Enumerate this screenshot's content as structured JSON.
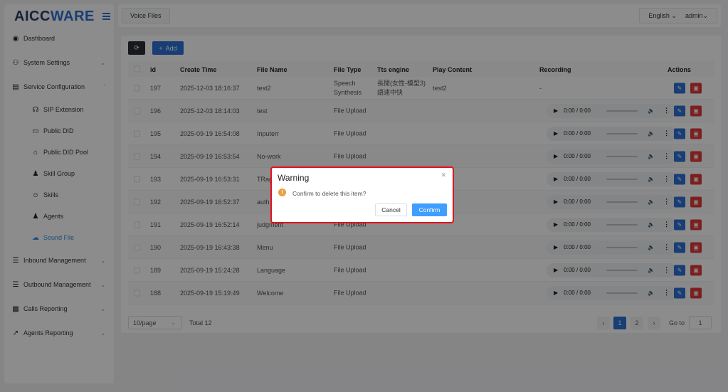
{
  "logo": {
    "main": "AICC",
    "accent": "WARE"
  },
  "sidebar": {
    "items": [
      {
        "label": "Dashboard",
        "icon": "dashboard-icon"
      },
      {
        "label": "System Settings",
        "icon": "users-icon"
      },
      {
        "label": "Service Configuration",
        "icon": "id-card-icon"
      },
      {
        "label": "SIP Extension",
        "icon": "headset-icon"
      },
      {
        "label": "Public DID",
        "icon": "folder-icon"
      },
      {
        "label": "Public DID Pool",
        "icon": "home-icon"
      },
      {
        "label": "Skill Group",
        "icon": "user-group-icon"
      },
      {
        "label": "Skills",
        "icon": "user-icon"
      },
      {
        "label": "Agents",
        "icon": "user-icon"
      },
      {
        "label": "Sound File",
        "icon": "cloud-icon",
        "active": true
      },
      {
        "label": "Inbound Management",
        "icon": "list-icon"
      },
      {
        "label": "Outbound Management",
        "icon": "list-icon"
      },
      {
        "label": "Calls Reporting",
        "icon": "bar-chart-icon"
      },
      {
        "label": "Agents Reporting",
        "icon": "line-chart-icon"
      }
    ]
  },
  "topbar": {
    "tab": "Voice Files",
    "language": "English",
    "user": "admin"
  },
  "toolbar": {
    "add_label": "Add"
  },
  "table": {
    "headers": [
      "id",
      "Create Time",
      "File Name",
      "File Type",
      "Tts engine",
      "Play Content",
      "Recording",
      "Actions"
    ],
    "rows": [
      {
        "id": "197",
        "time": "2025-12-03 18:16:37",
        "name": "test2",
        "type": "Speech Synthesis",
        "tts": "長閒(女性-模型3) 語速中快",
        "content": "test2",
        "recording": "-"
      },
      {
        "id": "196",
        "time": "2025-12-03 18:14:03",
        "name": "test",
        "type": "File Upload",
        "tts": "",
        "content": "",
        "recording": "0:00 / 0:00"
      },
      {
        "id": "195",
        "time": "2025-09-19 16:54:08",
        "name": "Inputerr",
        "type": "File Upload",
        "tts": "",
        "content": "",
        "recording": "0:00 / 0:00"
      },
      {
        "id": "194",
        "time": "2025-09-19 16:53:54",
        "name": "No-work",
        "type": "File Upload",
        "tts": "",
        "content": "",
        "recording": "0:00 / 0:00"
      },
      {
        "id": "193",
        "time": "2025-09-19 16:53:31",
        "name": "TRage",
        "type": "",
        "tts": "",
        "content": "",
        "recording": "0:00 / 0:00"
      },
      {
        "id": "192",
        "time": "2025-09-19 16:52:37",
        "name": "auth",
        "type": "",
        "tts": "",
        "content": "",
        "recording": "0:00 / 0:00"
      },
      {
        "id": "191",
        "time": "2025-09-19 16:52:14",
        "name": "judgment",
        "type": "File Upload",
        "tts": "",
        "content": "",
        "recording": "0:00 / 0:00"
      },
      {
        "id": "190",
        "time": "2025-09-19 16:43:38",
        "name": "Menu",
        "type": "File Upload",
        "tts": "",
        "content": "",
        "recording": "0:00 / 0:00"
      },
      {
        "id": "189",
        "time": "2025-09-19 15:24:28",
        "name": "Language",
        "type": "File Upload",
        "tts": "",
        "content": "",
        "recording": "0:00 / 0:00"
      },
      {
        "id": "188",
        "time": "2025-09-19 15:19:49",
        "name": "Welcome",
        "type": "File Upload",
        "tts": "",
        "content": "",
        "recording": "0:00 / 0:00"
      }
    ]
  },
  "pagination": {
    "page_size": "10/page",
    "total": "Total 12",
    "pages": [
      "1",
      "2"
    ],
    "current": "1",
    "goto_label": "Go to",
    "goto_value": "1"
  },
  "dialog": {
    "title": "Warning",
    "message": "Confirm to delete this item?",
    "cancel": "Cancel",
    "confirm": "Confirm"
  },
  "colors": {
    "primary": "#2f6fd6",
    "danger": "#e03b3b",
    "warning": "#e6a23c",
    "highlight": "#e3121c"
  }
}
